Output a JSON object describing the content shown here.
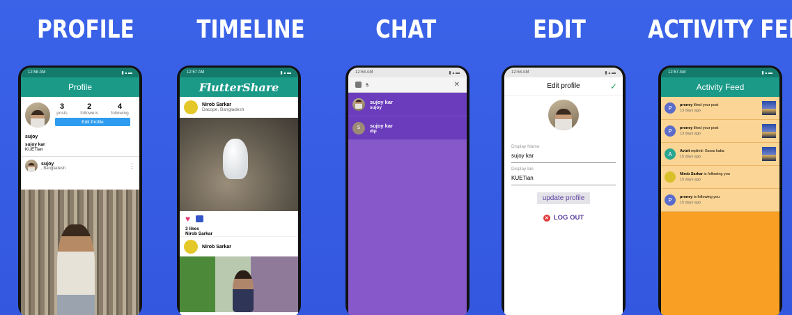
{
  "headings": {
    "profile": "PROFILE",
    "timeline": "TIMELINE",
    "chat": "CHAT",
    "edit": "EDIT",
    "activity": "ACTIVITY FEED"
  },
  "colors": {
    "background": "#3a63e8",
    "teal": "#1b9a88",
    "chat_purple": "#6b3cbc",
    "chat_body": "#8658c9",
    "activity_orange": "#f9a024",
    "activity_item": "#fbd595"
  },
  "profile_screen": {
    "time": "12:58 AM",
    "title": "Profile",
    "stats": [
      {
        "num": "3",
        "label": "posts"
      },
      {
        "num": "2",
        "label": "followers"
      },
      {
        "num": "4",
        "label": "following"
      }
    ],
    "edit_button": "Edit Profile",
    "username": "sujoy",
    "display_name": "sujoy kar",
    "bio": "KUETian",
    "post_user": "sujoy",
    "post_location": ", Bangladesh"
  },
  "timeline_screen": {
    "time": "12:57 AM",
    "app_name": "FlutterShare",
    "post_user": "Nirob Sarkar",
    "post_location": "Dacope, Bangladesh",
    "likes": "3 likes",
    "caption_user": "Nirob Sarkar",
    "next_post_user": "Nirob Sarkar"
  },
  "chat_screen": {
    "time": "12:58 AM",
    "search_value": "s",
    "results": [
      {
        "name": "sujoy kar",
        "username": "sujoy",
        "avatar": "photo"
      },
      {
        "name": "sujoy kar",
        "username": "dip",
        "avatar": "S"
      }
    ]
  },
  "edit_screen": {
    "time": "12:58 AM",
    "title": "Edit profile",
    "display_name_label": "Display Name",
    "display_name_value": "sujoy kar",
    "bio_label": "Display bio",
    "bio_value": "KUETian",
    "update_button": "update profile",
    "logout": "LOG OUT"
  },
  "activity_screen": {
    "time": "12:57 AM",
    "title": "Activity Feed",
    "items": [
      {
        "avatar": "P",
        "avatar_color": "#5a6bc9",
        "user": "proney",
        "text": " liked your post",
        "time": "13 days ago",
        "thumb": true
      },
      {
        "avatar": "P",
        "avatar_color": "#5a6bc9",
        "user": "proney",
        "text": " liked your post",
        "time": "13 days ago",
        "thumb": true
      },
      {
        "avatar": "A",
        "avatar_color": "#2aa692",
        "user": "Avizit",
        "text": " replied: Xosss kaka",
        "time": "15 days ago",
        "thumb": true
      },
      {
        "avatar": "",
        "avatar_color": "#d8c02a",
        "user": "Nirob Sarkar",
        "text": " is following you",
        "time": "15 days ago",
        "thumb": false
      },
      {
        "avatar": "P",
        "avatar_color": "#5a6bc9",
        "user": "proney",
        "text": " is following you",
        "time": "15 days ago",
        "thumb": false
      }
    ]
  }
}
